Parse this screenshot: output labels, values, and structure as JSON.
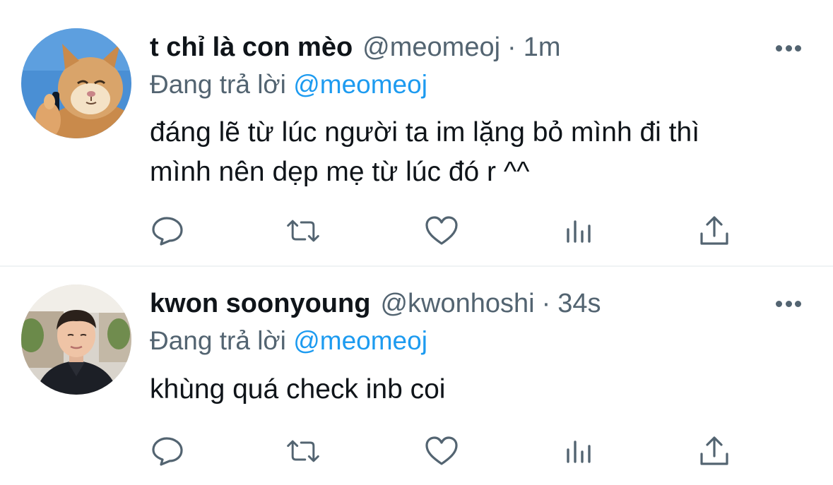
{
  "tweets": [
    {
      "display_name": "t chỉ là con mèo",
      "handle": "@meomeoj",
      "separator": "·",
      "time": "1m",
      "reply_prefix": "Đang trả lời",
      "reply_to": "@meomeoj",
      "text_lines": [
        "đáng lẽ từ lúc người ta im lặng bỏ mình đi thì",
        "mình nên dẹp mẹ từ lúc đó r ^^"
      ],
      "avatar": "cat-avatar"
    },
    {
      "display_name": "kwon soonyoung",
      "handle": "@kwonhoshi",
      "separator": "·",
      "time": "34s",
      "reply_prefix": "Đang trả lời",
      "reply_to": "@meomeoj",
      "text_lines": [
        "khùng quá check inb coi"
      ],
      "avatar": "person-avatar"
    }
  ],
  "icons": {
    "reply": "reply-icon",
    "retweet": "retweet-icon",
    "like": "heart-icon",
    "stats": "stats-icon",
    "share": "share-icon",
    "more": "more-icon"
  },
  "colors": {
    "text": "#0f1419",
    "secondary": "#536471",
    "accent": "#1d9bf0",
    "divider": "#eff3f4"
  }
}
